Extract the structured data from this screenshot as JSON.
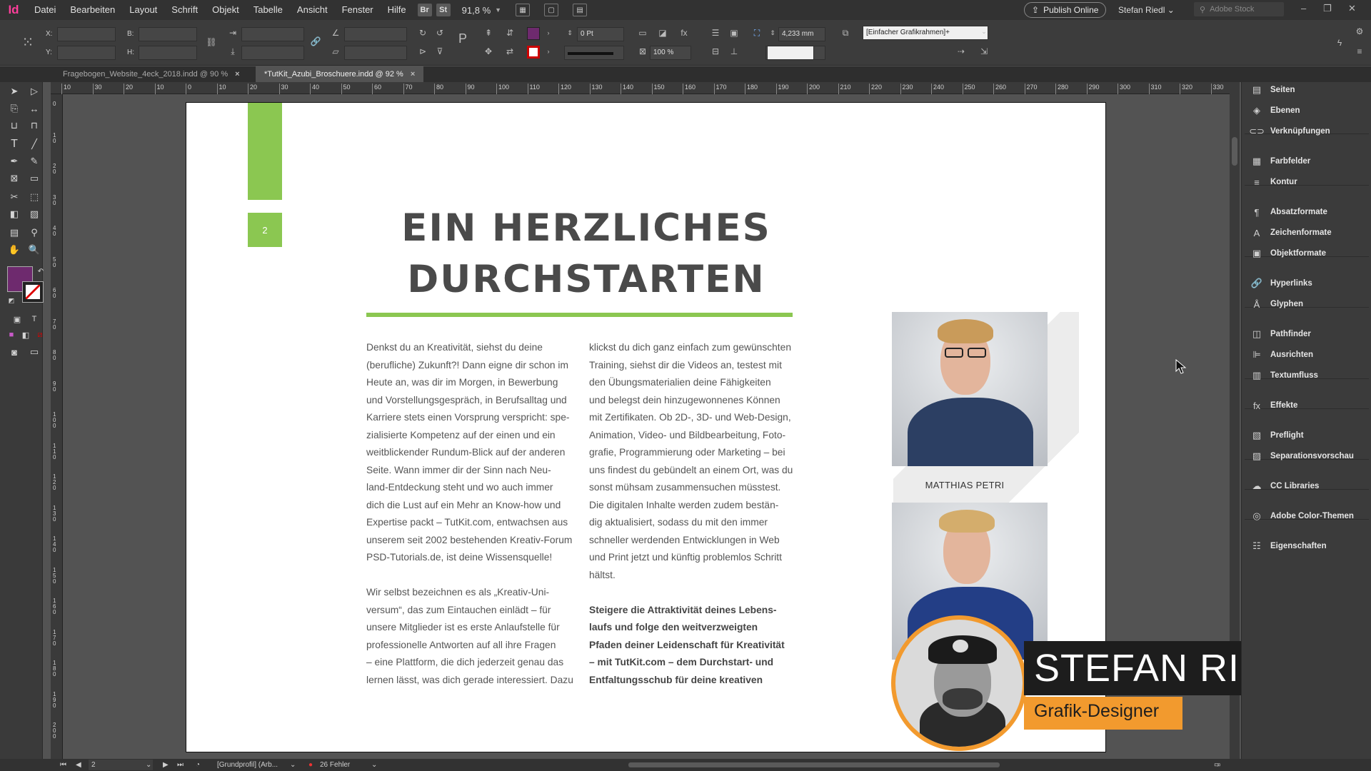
{
  "app": {
    "logo": "Id",
    "menus": [
      "Datei",
      "Bearbeiten",
      "Layout",
      "Schrift",
      "Objekt",
      "Tabelle",
      "Ansicht",
      "Fenster",
      "Hilfe"
    ],
    "bridge": "Br",
    "stock": "St",
    "zoom": "91,8 %",
    "publish": "Publish Online",
    "user": "Stefan Riedl",
    "search_placeholder": "Adobe Stock"
  },
  "control": {
    "x_label": "X:",
    "y_label": "Y:",
    "w_label": "B:",
    "h_label": "H:",
    "stroke_weight": "0 Pt",
    "opacity": "100 %",
    "gap": "4,233 mm",
    "object_style": "[Einfacher Grafikrahmen]+",
    "fill_color": "#6e2a6e"
  },
  "tabs": [
    {
      "label": "Fragebogen_Website_4eck_2018.indd @ 90 %",
      "active": false
    },
    {
      "label": "*TutKit_Azubi_Broschuere.indd @ 92 %",
      "active": true
    }
  ],
  "ruler": {
    "h": [
      "10",
      "30",
      "20",
      "10",
      "0",
      "10",
      "20",
      "30",
      "40",
      "50",
      "60",
      "70",
      "80",
      "90",
      "100",
      "110",
      "120",
      "130",
      "140",
      "150",
      "160",
      "170",
      "180",
      "190",
      "200",
      "210",
      "220",
      "230",
      "240",
      "250",
      "260",
      "270",
      "280",
      "290",
      "300",
      "310",
      "320",
      "330"
    ],
    "v": [
      "0",
      "1 0",
      "2 0",
      "3 0",
      "4 0",
      "5 0",
      "6 0",
      "7 0",
      "8 0",
      "9 0",
      "1 0 0",
      "1 1 0",
      "1 2 0",
      "1 3 0",
      "1 4 0",
      "1 5 0",
      "1 6 0",
      "1 7 0",
      "1 8 0",
      "1 9 0",
      "2 0 0"
    ]
  },
  "page": {
    "page_number": "2",
    "headline": [
      "EIN HERZLICHES",
      "DURCHSTARTEN"
    ],
    "col1": [
      "Denkst du an Kreativität, siehst du deine",
      "(berufliche) Zukunft?! Dann eigne dir schon im",
      "Heute an, was dir im Morgen, in Bewerbung",
      "und Vorstellungsgespräch, in Berufsalltag und",
      "Karriere stets einen Vorsprung verspricht: spe-",
      "zialisierte Kompetenz auf der einen und ein",
      "weitblickender Rundum-Blick auf der anderen",
      "Seite. Wann immer dir der Sinn nach Neu-",
      "land-Entdeckung steht und wo auch immer",
      "dich die Lust auf ein Mehr an Know-how und",
      "Expertise packt – TutKit.com, entwachsen aus",
      "unserem seit 2002 bestehenden Kreativ-Forum",
      "PSD-Tutorials.de, ist deine Wissensquelle!",
      "",
      "Wir selbst bezeichnen es als „Kreativ-Uni-",
      "versum“, das zum Eintauchen einlädt – für",
      "unsere Mitglieder ist es erste Anlaufstelle für",
      "professionelle Antworten auf all ihre Fragen",
      "– eine Plattform, die dich jederzeit genau das",
      "lernen lässt, was dich gerade interessiert. Dazu"
    ],
    "col2": [
      "klickst du dich ganz einfach zum gewünschten",
      "Training, siehst dir die Videos an, testest mit",
      "den Übungsmaterialien deine Fähigkeiten",
      "und belegst dein hinzugewonnenes Können",
      "mit Zertifikaten. Ob 2D-, 3D- und Web-Design,",
      "Animation, Video- und Bildbearbeitung, Foto-",
      "grafie, Programmierung oder Marketing – bei",
      "uns findest du gebündelt an einem Ort, was du",
      "sonst mühsam zusammensuchen müsstest.",
      "Die digitalen Inhalte werden zudem bestän-",
      "dig aktualisiert, sodass du mit den immer",
      "schneller werdenden Entwicklungen in Web",
      "und Print jetzt und künftig problemlos Schritt",
      "hältst."
    ],
    "col2_bold": [
      "Steigere die Attraktivität deines Lebens-",
      "laufs und folge den weitverzweigten",
      "Pfaden deiner Leidenschaft für Kreativität",
      "– mit TutKit.com – dem Durchstart- und",
      "Entfaltungsschub für deine kreativen"
    ],
    "caption": "MATTHIAS PETRI",
    "accent": "#8bc751"
  },
  "overlay": {
    "name": "STEFAN RIEDL",
    "role": "Grafik-Designer",
    "accent": "#f29a2e"
  },
  "panels": [
    {
      "label": "Seiten",
      "icon": "pages-icon",
      "glyph": "▤"
    },
    {
      "label": "Ebenen",
      "icon": "layers-icon",
      "glyph": "◈"
    },
    {
      "label": "Verknüpfungen",
      "icon": "links-icon",
      "glyph": "⊂⊃"
    },
    {
      "label": "Farbfelder",
      "icon": "swatches-icon",
      "glyph": "▦"
    },
    {
      "label": "Kontur",
      "icon": "stroke-icon",
      "glyph": "≡"
    },
    {
      "label": "Absatzformate",
      "icon": "paragraph-styles-icon",
      "glyph": "¶"
    },
    {
      "label": "Zeichenformate",
      "icon": "character-styles-icon",
      "glyph": "A"
    },
    {
      "label": "Objektformate",
      "icon": "object-styles-icon",
      "glyph": "▣"
    },
    {
      "label": "Hyperlinks",
      "icon": "hyperlinks-icon",
      "glyph": "🔗"
    },
    {
      "label": "Glyphen",
      "icon": "glyphs-icon",
      "glyph": "Å"
    },
    {
      "label": "Pathfinder",
      "icon": "pathfinder-icon",
      "glyph": "◫"
    },
    {
      "label": "Ausrichten",
      "icon": "align-icon",
      "glyph": "⊫"
    },
    {
      "label": "Textumfluss",
      "icon": "text-wrap-icon",
      "glyph": "▥"
    },
    {
      "label": "Effekte",
      "icon": "effects-icon",
      "glyph": "fx"
    },
    {
      "label": "Preflight",
      "icon": "preflight-icon",
      "glyph": "▧"
    },
    {
      "label": "Separationsvorschau",
      "icon": "separations-icon",
      "glyph": "▨"
    },
    {
      "label": "CC Libraries",
      "icon": "cc-libraries-icon",
      "glyph": "☁"
    },
    {
      "label": "Adobe Color-Themen",
      "icon": "color-themes-icon",
      "glyph": "◎"
    },
    {
      "label": "Eigenschaften",
      "icon": "properties-icon",
      "glyph": "☷"
    }
  ],
  "status": {
    "page": "2",
    "profile": "[Grundprofil] (Arb...",
    "errors": "26 Fehler"
  }
}
